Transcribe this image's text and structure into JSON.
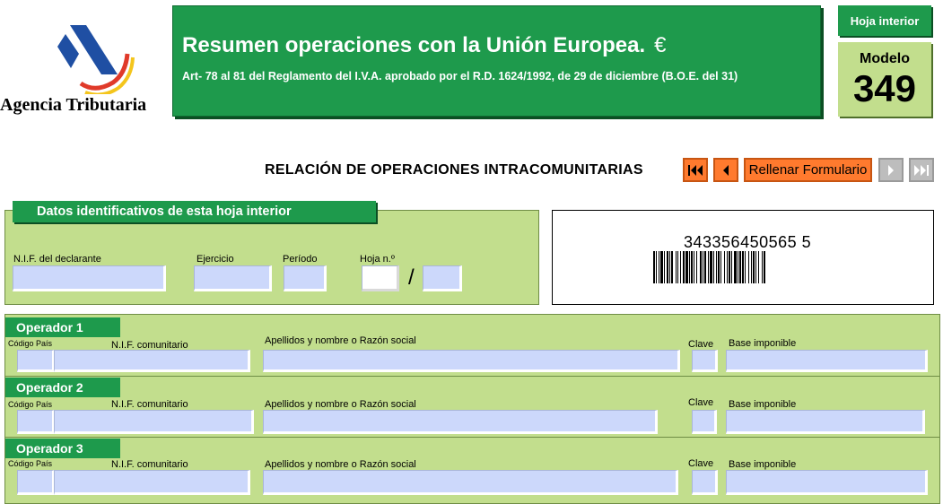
{
  "header": {
    "agency_name": "Agencia Tributaria",
    "title": "Resumen operaciones con la Unión Europea.",
    "euro_symbol": "€",
    "subtitle": "Art- 78 al 81 del Reglamento del I.V.A. aprobado por el R.D. 1624/1992, de 29 de diciembre (B.O.E. del 31)",
    "sheet_type": "Hoja interior",
    "model_label": "Modelo",
    "model_number": "349"
  },
  "section_title": "RELACIÓN DE OPERACIONES INTRACOMUNITARIAS",
  "navigation": {
    "first_icon": "skip-first-icon",
    "prev_icon": "prev-icon",
    "fill_label": "Rellenar Formulario",
    "next_icon": "next-icon",
    "last_icon": "skip-last-icon",
    "active_color": "#ff7a2e",
    "disabled_color": "#bdbdbd"
  },
  "datos": {
    "tab_label": "Datos identificativos de esta hoja interior",
    "nif_label": "N.I.F. del declarante",
    "nif_value": "",
    "ejercicio_label": "Ejercicio",
    "ejercicio_value": "",
    "periodo_label": "Período",
    "periodo_value": "",
    "hoja_label": "Hoja n.º",
    "hoja_value": "",
    "hoja_total_value": "",
    "separator": "/"
  },
  "barcode": {
    "number": "343356450565 5"
  },
  "operators": [
    {
      "title": "Operador 1",
      "codigo_pais_label": "Código País",
      "nif_label": "N.I.F. comunitario",
      "nombre_label": "Apellidos y nombre o Razón social",
      "clave_label": "Clave",
      "base_label": "Base imponible",
      "codigo_pais": "",
      "nif": "",
      "nombre": "",
      "clave": "",
      "base": ""
    },
    {
      "title": "Operador 2",
      "codigo_pais_label": "Código País",
      "nif_label": "N.I.F. comunitario",
      "nombre_label": "Apellidos y nombre o Razón social",
      "clave_label": "Clave",
      "base_label": "Base imponible",
      "codigo_pais": "",
      "nif": "",
      "nombre": "",
      "clave": "",
      "base": ""
    },
    {
      "title": "Operador 3",
      "codigo_pais_label": "Código País",
      "nif_label": "N.I.F. comunitario",
      "nombre_label": "Apellidos y nombre o Razón social",
      "clave_label": "Clave",
      "base_label": "Base imponible",
      "codigo_pais": "",
      "nif": "",
      "nombre": "",
      "clave": "",
      "base": ""
    }
  ],
  "colors": {
    "brand_green": "#1e9a4c",
    "panel_green": "#c2de8d",
    "field_blue": "#ccd8fb",
    "accent_orange": "#ff7a2e"
  }
}
